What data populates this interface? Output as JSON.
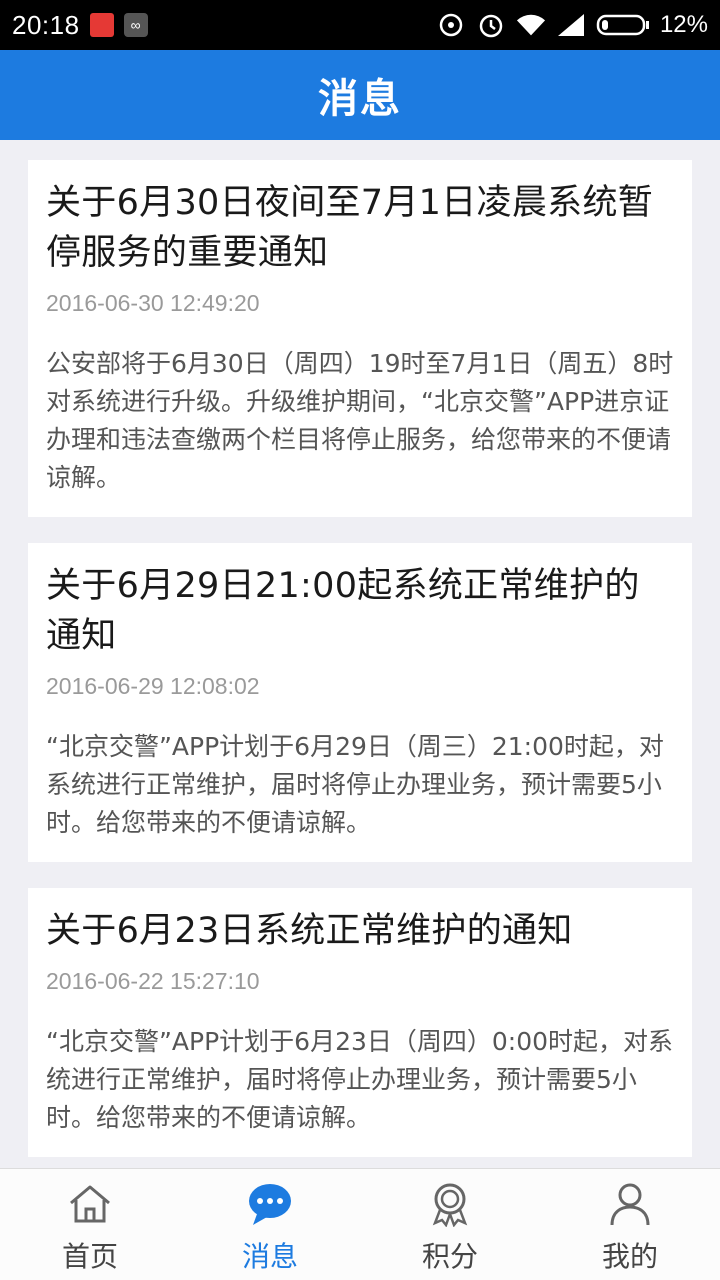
{
  "status_bar": {
    "time": "20:18",
    "battery": "12%"
  },
  "header": {
    "title": "消息"
  },
  "messages": [
    {
      "title": "关于6月30日夜间至7月1日凌晨系统暂停服务的重要通知",
      "time": "2016-06-30 12:49:20",
      "body": "公安部将于6月30日（周四）19时至7月1日（周五）8时对系统进行升级。升级维护期间，“北京交警”APP进京证办理和违法查缴两个栏目将停止服务，给您带来的不便请谅解。"
    },
    {
      "title": "关于6月29日21:00起系统正常维护的通知",
      "time": "2016-06-29 12:08:02",
      "body": "“北京交警”APP计划于6月29日（周三）21:00时起，对系统进行正常维护，届时将停止办理业务，预计需要5小时。给您带来的不便请谅解。"
    },
    {
      "title": "关于6月23日系统正常维护的通知",
      "time": "2016-06-22 15:27:10",
      "body": "“北京交警”APP计划于6月23日（周四）0:00时起，对系统进行正常维护，届时将停止办理业务，预计需要5小时。给您带来的不便请谅解。"
    }
  ],
  "bottom_nav": {
    "items": [
      {
        "label": "首页",
        "icon": "home-icon"
      },
      {
        "label": "消息",
        "icon": "chat-bubble-icon"
      },
      {
        "label": "积分",
        "icon": "award-badge-icon"
      },
      {
        "label": "我的",
        "icon": "person-icon"
      }
    ],
    "active_index": 1
  },
  "colors": {
    "primary": "#1d7be0",
    "background": "#efeff4",
    "title_text": "#1a1a1a",
    "time_text": "#9a9a9a",
    "body_text": "#555555"
  }
}
